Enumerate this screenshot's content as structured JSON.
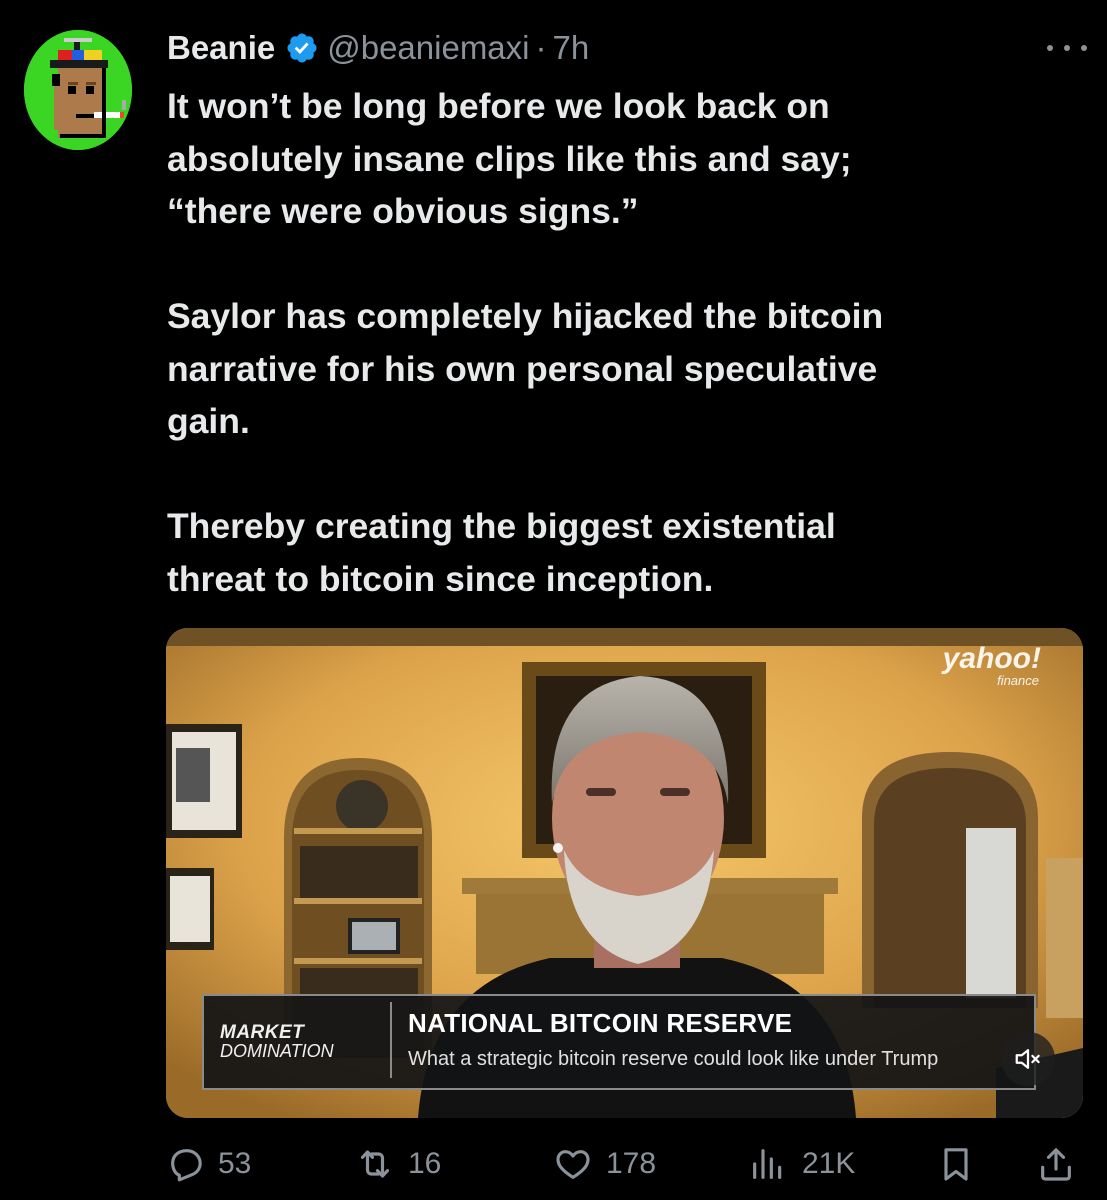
{
  "tweet": {
    "author_name": "Beanie",
    "handle": "@beaniemaxi",
    "separator": "·",
    "time": "7h",
    "paragraphs": [
      [
        "It won’t be long before we look back on",
        "absolutely insane clips like this and say;",
        "“there were obvious signs.”"
      ],
      [
        "Saylor has completely hijacked the bitcoin",
        "narrative for his own personal speculative",
        "gain."
      ],
      [
        "Thereby creating the biggest existential",
        "threat to bitcoin since inception."
      ]
    ]
  },
  "video": {
    "brand_line1": "yahoo!",
    "brand_line2": "finance",
    "show_line1": "MARKET",
    "show_line2": "DOMINATION",
    "headline": "NATIONAL BITCOIN RESERVE",
    "subheadline": "What a strategic bitcoin reserve could look like under Trump",
    "muted": true
  },
  "actions": {
    "replies": "53",
    "reposts": "16",
    "likes": "178",
    "views": "21K"
  },
  "colors": {
    "background": "#000000",
    "text": "#e7e9ea",
    "muted_text": "#8b9299",
    "verified_blue": "#1d9bf0",
    "avatar_green": "#3bd624"
  }
}
